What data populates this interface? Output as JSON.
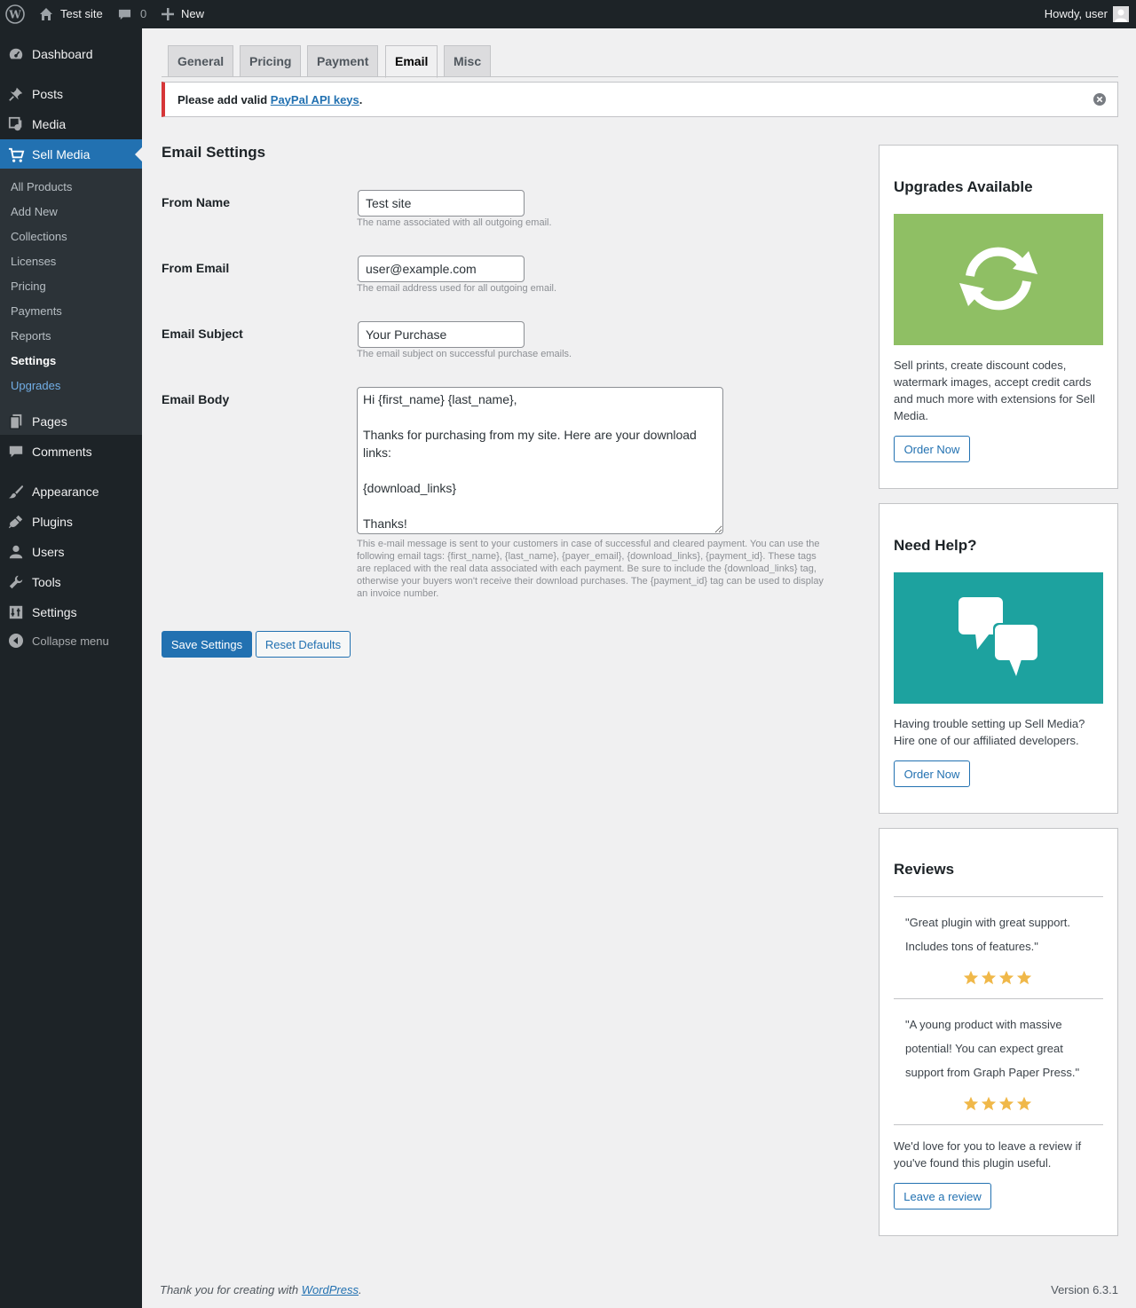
{
  "adminbar": {
    "site_name": "Test site",
    "comments_count": "0",
    "new_label": "New",
    "howdy": "Howdy, user"
  },
  "sidebar": {
    "items": [
      {
        "label": "Dashboard",
        "icon": "dashboard-icon"
      },
      {
        "label": "Posts",
        "icon": "pin-icon"
      },
      {
        "label": "Media",
        "icon": "media-icon"
      },
      {
        "label": "Sell Media",
        "icon": "cart-icon"
      },
      {
        "label": "Pages",
        "icon": "pages-icon"
      },
      {
        "label": "Comments",
        "icon": "comment-icon"
      },
      {
        "label": "Appearance",
        "icon": "brush-icon"
      },
      {
        "label": "Plugins",
        "icon": "plug-icon"
      },
      {
        "label": "Users",
        "icon": "user-icon"
      },
      {
        "label": "Tools",
        "icon": "wrench-icon"
      },
      {
        "label": "Settings",
        "icon": "settings-icon"
      },
      {
        "label": "Collapse menu",
        "icon": "collapse-icon"
      }
    ],
    "submenu": [
      "All Products",
      "Add New",
      "Collections",
      "Licenses",
      "Pricing",
      "Payments",
      "Reports",
      "Settings",
      "Upgrades"
    ]
  },
  "tabs": [
    "General",
    "Pricing",
    "Payment",
    "Email",
    "Misc"
  ],
  "notice": {
    "prefix": "Please add valid ",
    "link": "PayPal API keys",
    "suffix": "."
  },
  "form": {
    "title": "Email Settings",
    "from_name": {
      "label": "From Name",
      "value": "Test site",
      "desc": "The name associated with all outgoing email."
    },
    "from_email": {
      "label": "From Email",
      "value": "user@example.com",
      "desc": "The email address used for all outgoing email."
    },
    "subject": {
      "label": "Email Subject",
      "value": "Your Purchase",
      "desc": "The email subject on successful purchase emails."
    },
    "body": {
      "label": "Email Body",
      "value": "Hi {first_name} {last_name},\n\nThanks for purchasing from my site. Here are your download links:\n\n{download_links}\n\nThanks!",
      "desc": "This e-mail message is sent to your customers in case of successful and cleared payment. You can use the following email tags: {first_name}, {last_name}, {payer_email}, {download_links}, {payment_id}. These tags are replaced with the real data associated with each payment. Be sure to include the {download_links} tag, otherwise your buyers won't receive their download purchases. The {payment_id} tag can be used to display an invoice number."
    },
    "save_label": "Save Settings",
    "reset_label": "Reset Defaults"
  },
  "boxes": {
    "upgrades": {
      "title": "Upgrades Available",
      "text": "Sell prints, create discount codes, watermark images, accept credit cards and much more with extensions for Sell Media.",
      "button": "Order Now",
      "color": "#8fbf64"
    },
    "help": {
      "title": "Need Help?",
      "text": "Having trouble setting up Sell Media? Hire one of our affiliated developers.",
      "button": "Order Now",
      "color": "#1da29f"
    },
    "reviews": {
      "title": "Reviews",
      "items": [
        {
          "quote": "\"Great plugin with great support. Includes tons of features.\"",
          "stars": 4
        },
        {
          "quote": "\"A young product with massive potential! You can expect great support from Graph Paper Press.\"",
          "stars": 4
        }
      ],
      "text": "We'd love for you to leave a review if you've found this plugin useful.",
      "button": "Leave a review"
    }
  },
  "footer": {
    "thanks_prefix": "Thank you for creating with ",
    "thanks_link": "WordPress",
    "thanks_suffix": ".",
    "version": "Version 6.3.1"
  },
  "colors": {
    "accent": "#2271b1",
    "error": "#d63638",
    "star": "#f0b849"
  }
}
